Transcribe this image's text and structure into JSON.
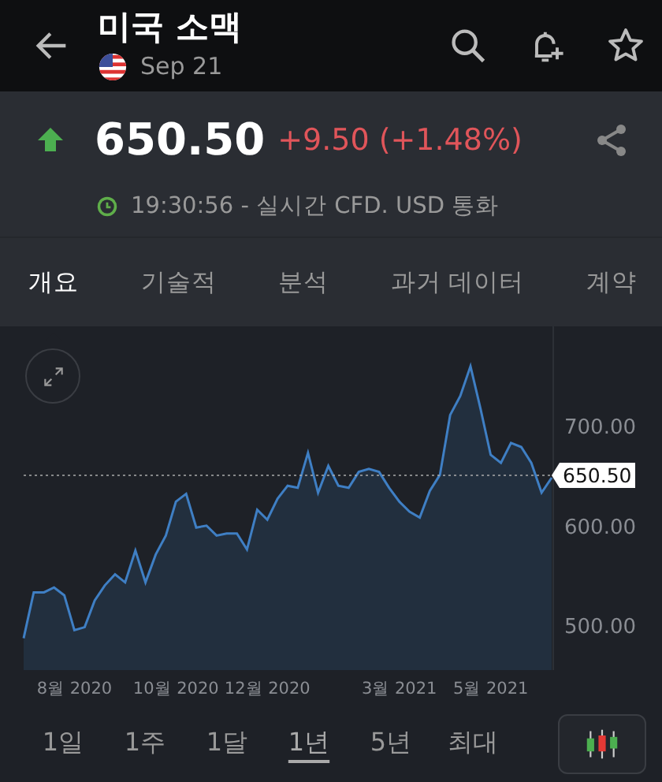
{
  "header": {
    "title": "미국 소맥",
    "date": "Sep 21"
  },
  "quote": {
    "price": "650.50",
    "change": "+9.50 (+1.48%)",
    "rising": true,
    "time_note": "19:30:56 - 실시간 CFD. USD 통화"
  },
  "tabs": [
    {
      "label": "개요",
      "selected": true
    },
    {
      "label": "기술적",
      "selected": false
    },
    {
      "label": "분석",
      "selected": false
    },
    {
      "label": "과거 데이터",
      "selected": false
    },
    {
      "label": "계약",
      "selected": false
    }
  ],
  "chart": {
    "chart_data": {
      "type": "area",
      "categories": [
        null,
        null,
        null,
        null,
        null,
        "8월 2020",
        null,
        null,
        null,
        null,
        null,
        null,
        null,
        null,
        null,
        "10월 2020",
        null,
        null,
        null,
        null,
        null,
        null,
        null,
        null,
        "12월 2020",
        null,
        null,
        null,
        null,
        null,
        null,
        null,
        null,
        null,
        null,
        null,
        null,
        "3월 2021",
        null,
        null,
        null,
        null,
        null,
        null,
        null,
        null,
        "5월 2021",
        null,
        null,
        null,
        null,
        null,
        null
      ],
      "series": [
        {
          "color": "#3f7fc4",
          "values": [
            487,
            533,
            533,
            538,
            530,
            495,
            498,
            525,
            540,
            551,
            543,
            575,
            543,
            571,
            590,
            624,
            632,
            598,
            600,
            590,
            592,
            592,
            576,
            616,
            606,
            627,
            640,
            638,
            673,
            633,
            660,
            640,
            638,
            654,
            657,
            654,
            638,
            624,
            614,
            608,
            635,
            651,
            711,
            730,
            760,
            717,
            671,
            663,
            683,
            679,
            663,
            633,
            648
          ]
        }
      ],
      "ylim": [
        455,
        800
      ],
      "yticks": [
        {
          "value": 500,
          "label": "500.00"
        },
        {
          "value": 600,
          "label": "600.00"
        },
        {
          "value": 700,
          "label": "700.00"
        }
      ],
      "ref_lines": [
        {
          "axis": "y",
          "value": 650.5,
          "label": "650.50"
        }
      ]
    }
  },
  "periods": [
    {
      "label": "1일",
      "selected": false
    },
    {
      "label": "1주",
      "selected": false
    },
    {
      "label": "1달",
      "selected": false
    },
    {
      "label": "1년",
      "selected": true
    },
    {
      "label": "5년",
      "selected": false
    },
    {
      "label": "최대",
      "selected": false
    }
  ]
}
